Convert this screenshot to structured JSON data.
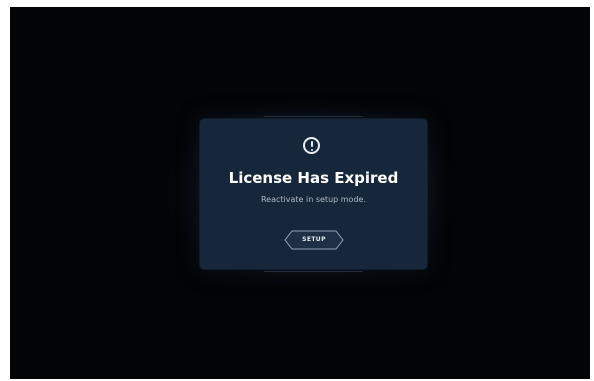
{
  "dialog": {
    "icon": "alert-circle-icon",
    "title": "License Has Expired",
    "message": "Reactivate in setup mode.",
    "button_label": "SETUP"
  },
  "colors": {
    "background": "#030406",
    "dialog": "#17273b",
    "text": "#ffffff",
    "subtext": "#aeb9c6",
    "button_border": "#8fa3b8"
  }
}
